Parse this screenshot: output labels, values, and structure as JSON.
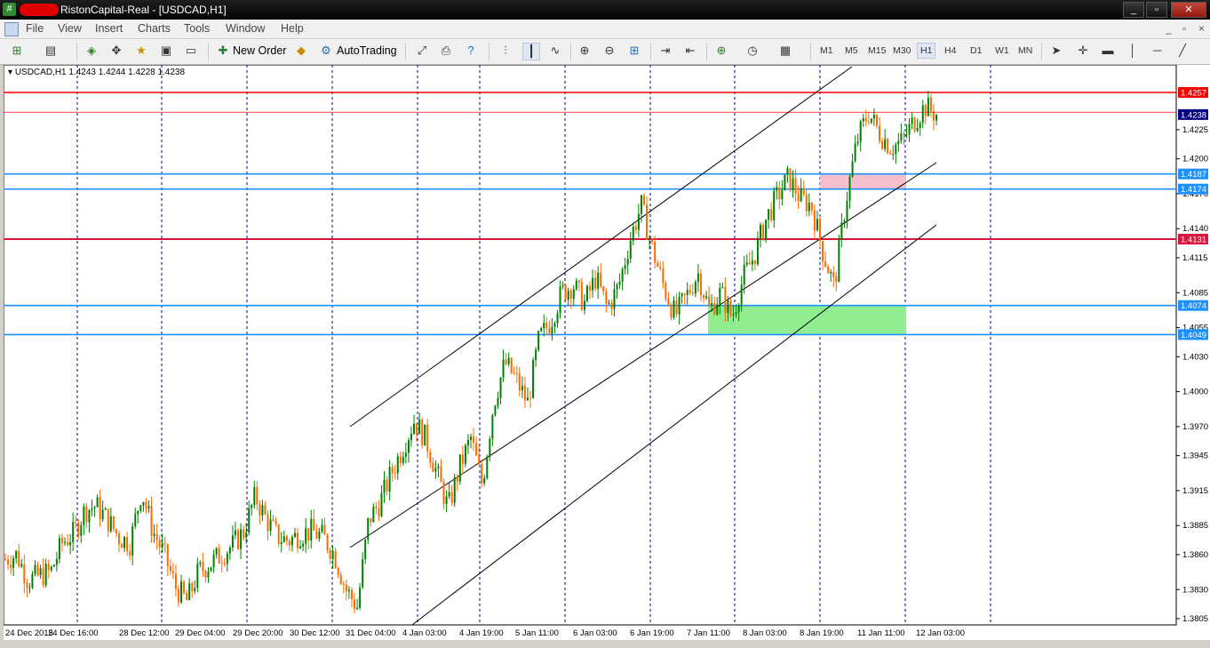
{
  "window": {
    "title": "RistonCapital-Real - [USDCAD,H1]",
    "app_icon": "mt4-icon",
    "buttons": [
      "minimize",
      "maximize",
      "close"
    ]
  },
  "menu": {
    "items": [
      "File",
      "View",
      "Insert",
      "Charts",
      "Tools",
      "Window",
      "Help"
    ],
    "mdi_buttons": [
      "_",
      "▫",
      "×"
    ]
  },
  "toolbar": {
    "new_order_label": "New Order",
    "autotrading_label": "AutoTrading",
    "timeframes": [
      "M1",
      "M5",
      "M15",
      "M30",
      "H1",
      "H4",
      "D1",
      "W1",
      "MN"
    ],
    "active_timeframe": "H1"
  },
  "chart_info": {
    "symbol_line": "USDCAD,H1  1.4243 1.4244 1.4228 1.4238"
  },
  "chart_data": {
    "type": "candlestick",
    "symbol": "USDCAD",
    "timeframe": "H1",
    "ylim": [
      1.379,
      1.4285
    ],
    "y_ticks": [
      "1.4225",
      "1.4200",
      "1.4170",
      "1.4140",
      "1.4115",
      "1.4085",
      "1.4055",
      "1.4030",
      "1.4000",
      "1.3970",
      "1.3945",
      "1.3915",
      "1.3885",
      "1.3860",
      "1.3830",
      "1.3805"
    ],
    "x_labels": [
      "24 Dec 2015",
      "24 Dec 16:00",
      "28 Dec 12:00",
      "29 Dec 04:00",
      "29 Dec 20:00",
      "30 Dec 12:00",
      "31 Dec 04:00",
      "4 Jan 03:00",
      "4 Jan 19:00",
      "5 Jan 11:00",
      "6 Jan 03:00",
      "6 Jan 19:00",
      "7 Jan 11:00",
      "8 Jan 03:00",
      "8 Jan 19:00",
      "11 Jan 11:00",
      "12 Jan 03:00"
    ],
    "price_levels": [
      {
        "label": "1.4257",
        "value": 1.4257,
        "color": "#ff0000"
      },
      {
        "label": "1.4187",
        "value": 1.4187,
        "color": "#1e90ff"
      },
      {
        "label": "1.4174",
        "value": 1.4174,
        "color": "#1e90ff"
      },
      {
        "label": "1.4131",
        "value": 1.4131,
        "color": "#dc143c"
      },
      {
        "label": "1.4074",
        "value": 1.4074,
        "color": "#1e90ff"
      },
      {
        "label": "1.4049",
        "value": 1.4049,
        "color": "#1e90ff"
      }
    ],
    "current_price": {
      "label": "1.4238",
      "value": 1.4238
    },
    "close_path": [
      1.3856,
      1.386,
      1.3838,
      1.3842,
      1.3845,
      1.387,
      1.3878,
      1.3898,
      1.3902,
      1.389,
      1.3875,
      1.387,
      1.3915,
      1.388,
      1.386,
      1.3832,
      1.382,
      1.3845,
      1.3852,
      1.386,
      1.3868,
      1.388,
      1.391,
      1.389,
      1.3875,
      1.3872,
      1.3878,
      1.388,
      1.3875,
      1.386,
      1.383,
      1.3815,
      1.389,
      1.3905,
      1.393,
      1.3952,
      1.3975,
      1.396,
      1.393,
      1.39,
      1.3935,
      1.396,
      1.392,
      1.399,
      1.4025,
      1.401,
      1.399,
      1.4045,
      1.406,
      1.4085,
      1.4092,
      1.4076,
      1.4098,
      1.4072,
      1.409,
      1.413,
      1.416,
      1.4122,
      1.409,
      1.4065,
      1.4082,
      1.4102,
      1.407,
      1.4085,
      1.4064,
      1.4098,
      1.4118,
      1.4148,
      1.4168,
      1.4184,
      1.4166,
      1.416,
      1.412,
      1.409,
      1.4162,
      1.4215,
      1.424,
      1.4222,
      1.421,
      1.4215,
      1.4232,
      1.4245,
      1.4238
    ],
    "legend": "none",
    "grid": "vertical dashed"
  }
}
